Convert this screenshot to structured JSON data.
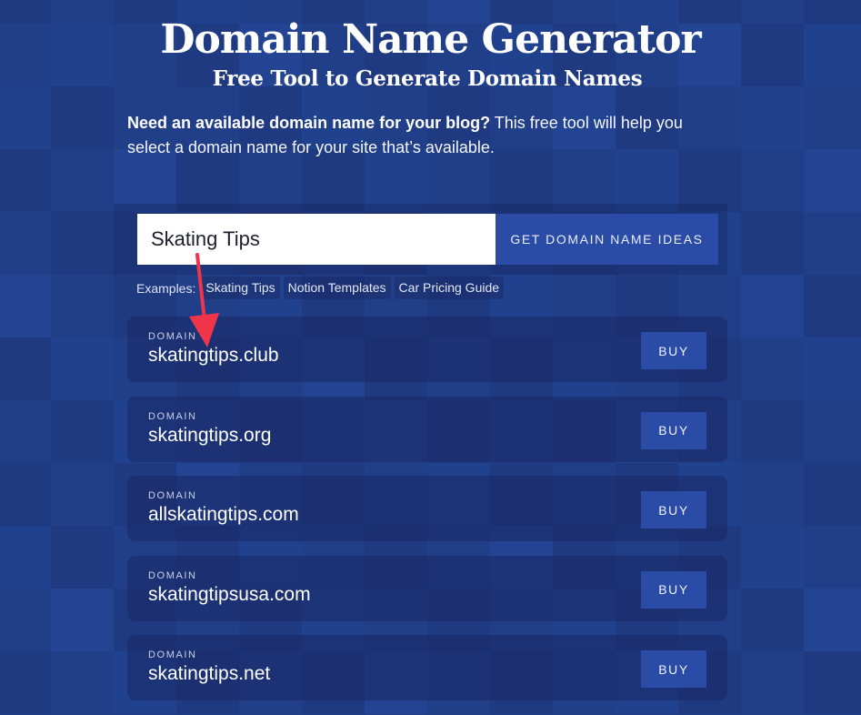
{
  "header": {
    "title": "Domain Name Generator",
    "subtitle": "Free Tool to Generate Domain Names"
  },
  "intro": {
    "bold": "Need an available domain name for your blog?",
    "text": " This free tool will help you select a domain name for your site that’s available."
  },
  "search": {
    "value": "Skating Tips",
    "button_label": "GET DOMAIN NAME IDEAS"
  },
  "examples": {
    "label": "Examples:",
    "items": [
      "Skating Tips",
      "Notion Templates",
      "Car Pricing Guide"
    ]
  },
  "results": [
    {
      "kicker": "DOMAIN",
      "domain": "skatingtips.club",
      "button": "BUY"
    },
    {
      "kicker": "DOMAIN",
      "domain": "skatingtips.org",
      "button": "BUY"
    },
    {
      "kicker": "DOMAIN",
      "domain": "allskatingtips.com",
      "button": "BUY"
    },
    {
      "kicker": "DOMAIN",
      "domain": "skatingtipsusa.com",
      "button": "BUY"
    },
    {
      "kicker": "DOMAIN",
      "domain": "skatingtips.net",
      "button": "BUY"
    }
  ],
  "annotation": {
    "type": "arrow",
    "color": "#f0354a"
  },
  "colors": {
    "background": "#203d87",
    "accent_button": "#2a4ba6",
    "tile_shades": [
      "#1f3a80",
      "#213e88",
      "#1f418e",
      "#234493",
      "#1e3a84"
    ]
  }
}
